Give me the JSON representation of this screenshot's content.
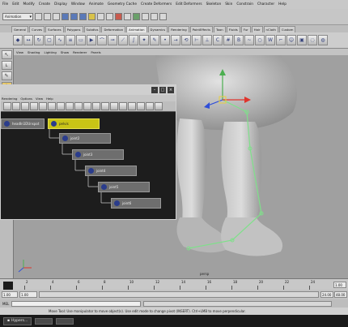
{
  "menubar": {
    "items": [
      "File",
      "Edit",
      "Modify",
      "Create",
      "Display",
      "Window",
      "Animate",
      "Geometry Cache",
      "Create Deformers",
      "Edit Deformers",
      "Skeleton",
      "Skin",
      "Constrain",
      "Character",
      "Help"
    ]
  },
  "status": {
    "mode": "Animation"
  },
  "shelf": {
    "tabs": [
      "General",
      "Curves",
      "Surfaces",
      "Polygons",
      "Subdivs",
      "Deformation",
      "Animation",
      "Dynamics",
      "Rendering",
      "PaintEffects",
      "Toon",
      "Fluids",
      "Fur",
      "Hair",
      "nCloth",
      "Custom"
    ],
    "active_tab": "Animation"
  },
  "panel_menu": {
    "items": [
      "View",
      "Shading",
      "Lighting",
      "Show",
      "Renderer",
      "Panels"
    ]
  },
  "viewport": {
    "camera_label": "persp",
    "background": "#a0a0a0"
  },
  "hypergraph": {
    "menu": [
      "Rendering",
      "Options",
      "View",
      "Help"
    ],
    "nodes": [
      {
        "label": "headIn1DUnspot",
        "selected": false
      },
      {
        "label": "pelvis",
        "selected": true
      },
      {
        "label": "joint2",
        "selected": false
      },
      {
        "label": "joint3",
        "selected": false
      },
      {
        "label": "joint4",
        "selected": false
      },
      {
        "label": "joint5",
        "selected": false
      },
      {
        "label": "joint6",
        "selected": false
      }
    ]
  },
  "timeline": {
    "ticks": [
      "2",
      "4",
      "6",
      "8",
      "10",
      "12",
      "14",
      "16",
      "18",
      "20",
      "22",
      "24"
    ],
    "current_frame": "1.00",
    "end_field": "1.00",
    "range_start": "1.00",
    "range_end": "24.00",
    "field_start": "1.00",
    "field_end": "48.00"
  },
  "command": {
    "label": "MEL"
  },
  "help_line": "Move Tool: Use manipulator to move object(s). Use edit mode to change pivot (INSERT). Ctrl+LMB to move perpendicular.",
  "taskbar": {
    "task_label": "Hypers..."
  },
  "colors": {
    "selected_node": "#c9c416",
    "joint": "#7fe08a",
    "manip_x": "#e0342c",
    "manip_y": "#4caf50",
    "manip_z": "#2f4fd8"
  }
}
